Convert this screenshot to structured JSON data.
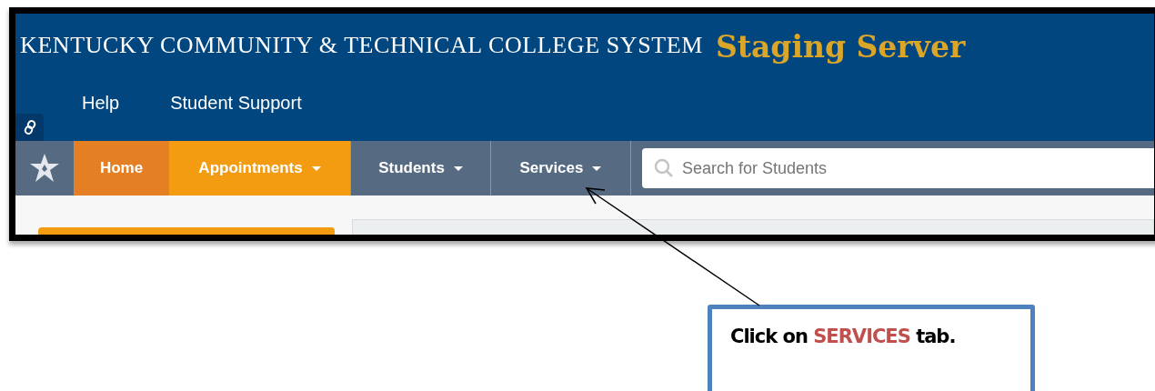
{
  "header": {
    "title": "KENTUCKY COMMUNITY & TECHNICAL COLLEGE SYSTEM",
    "badge": "Staging Server",
    "links": [
      "Help",
      "Student Support"
    ]
  },
  "nav": {
    "tabs": [
      {
        "label": "Home",
        "color": "#e57f24",
        "has_menu": false
      },
      {
        "label": "Appointments",
        "color": "#f39c12",
        "has_menu": true
      },
      {
        "label": "Students",
        "color": "#566a82",
        "has_menu": true
      },
      {
        "label": "Services",
        "color": "#566a82",
        "has_menu": true
      }
    ]
  },
  "search": {
    "placeholder": "Search for Students"
  },
  "callout": {
    "parts": [
      {
        "text": "Click on ",
        "kind": "plain"
      },
      {
        "text": "SERVICES",
        "kind": "highlight"
      },
      {
        "text": " tab.",
        "kind": "plain"
      }
    ]
  }
}
